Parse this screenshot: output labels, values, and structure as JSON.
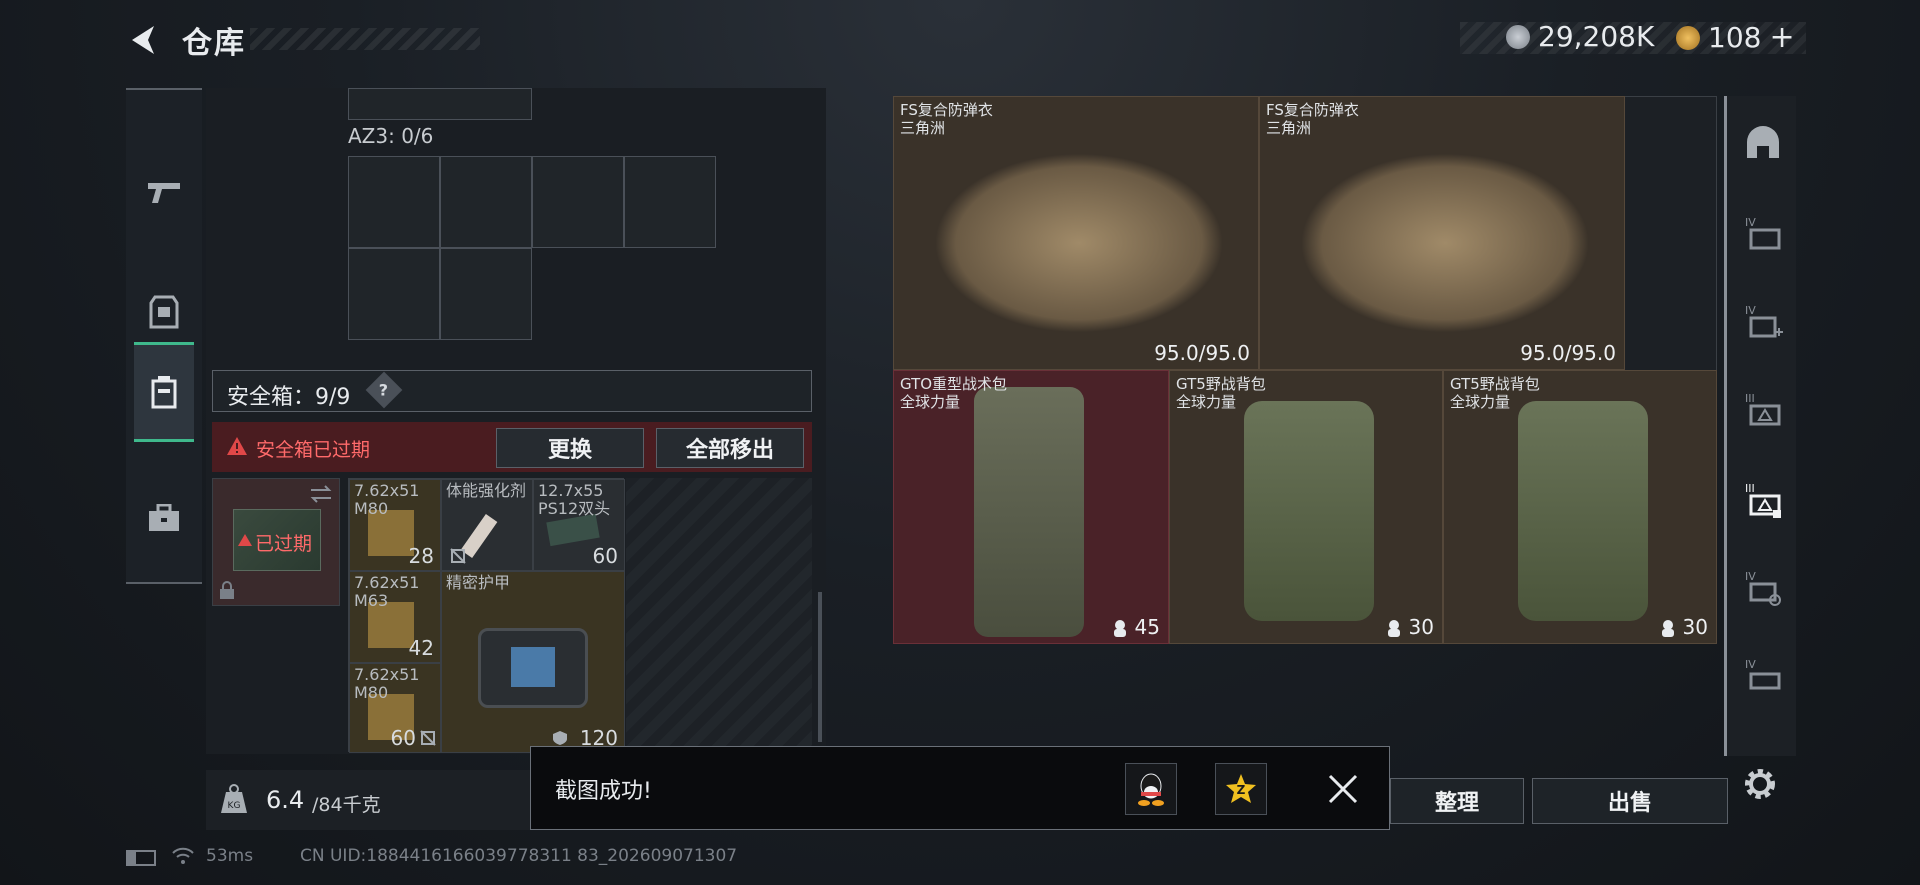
{
  "header": {
    "title": "仓库",
    "silver": "29,208K",
    "gold": "108",
    "plus": "+"
  },
  "left_nav": [
    {
      "icon": "pistol-icon"
    },
    {
      "icon": "armor-vest-icon"
    },
    {
      "icon": "safe-case-icon",
      "active": true
    },
    {
      "icon": "briefcase-icon"
    }
  ],
  "storage": {
    "az3_label": "AZ3: 0/6"
  },
  "safe_box": {
    "label": "安全箱：9/9",
    "help": "?",
    "expired_warning": "安全箱已过期",
    "replace_button": "更换",
    "move_all_button": "全部移出",
    "expired_tag": "已过期"
  },
  "safe_items": [
    {
      "name": "7.62x51 M80",
      "count": "28"
    },
    {
      "name": "体能强化剂",
      "count": ""
    },
    {
      "name": "12.7x55 PS12双头",
      "count": "60"
    },
    {
      "name": "7.62x51 M63",
      "count": "42"
    },
    {
      "name": "精密护甲",
      "count": "120"
    },
    {
      "name": "7.62x51 M80",
      "count": "60"
    }
  ],
  "weight": {
    "current": "6.4",
    "max": "/84千克"
  },
  "right_items": [
    {
      "name": "FS复合防弹衣",
      "sub": "三角洲",
      "value": "95.0/95.0"
    },
    {
      "name": "FS复合防弹衣",
      "sub": "三角洲",
      "value": "95.0/95.0"
    },
    {
      "name": "GTO重型战术包",
      "sub": "全球力量",
      "value": "45"
    },
    {
      "name": "GT5野战背包",
      "sub": "全球力量",
      "value": "30"
    },
    {
      "name": "GT5野战背包",
      "sub": "全球力量",
      "value": "30"
    }
  ],
  "right_nav": [
    "helmet-icon",
    "armor-iv-icon",
    "armor-iv-plus-icon",
    "armor-iii-icon",
    "armor-iii-selected-icon",
    "armor-iv-search-icon",
    "armor-iv-card-icon"
  ],
  "actions": {
    "sort": "整理",
    "sell": "出售"
  },
  "toast": {
    "message": "截图成功!",
    "qq": "qq-icon",
    "star": "qzone-icon"
  },
  "status": {
    "ping": "53ms",
    "uid": "CN UID:1884416166039778311 83_202609071307"
  },
  "colors": {
    "accent_green": "#3fb98c",
    "warning_red": "#e04848",
    "expired_bg": "#4a1c20"
  }
}
